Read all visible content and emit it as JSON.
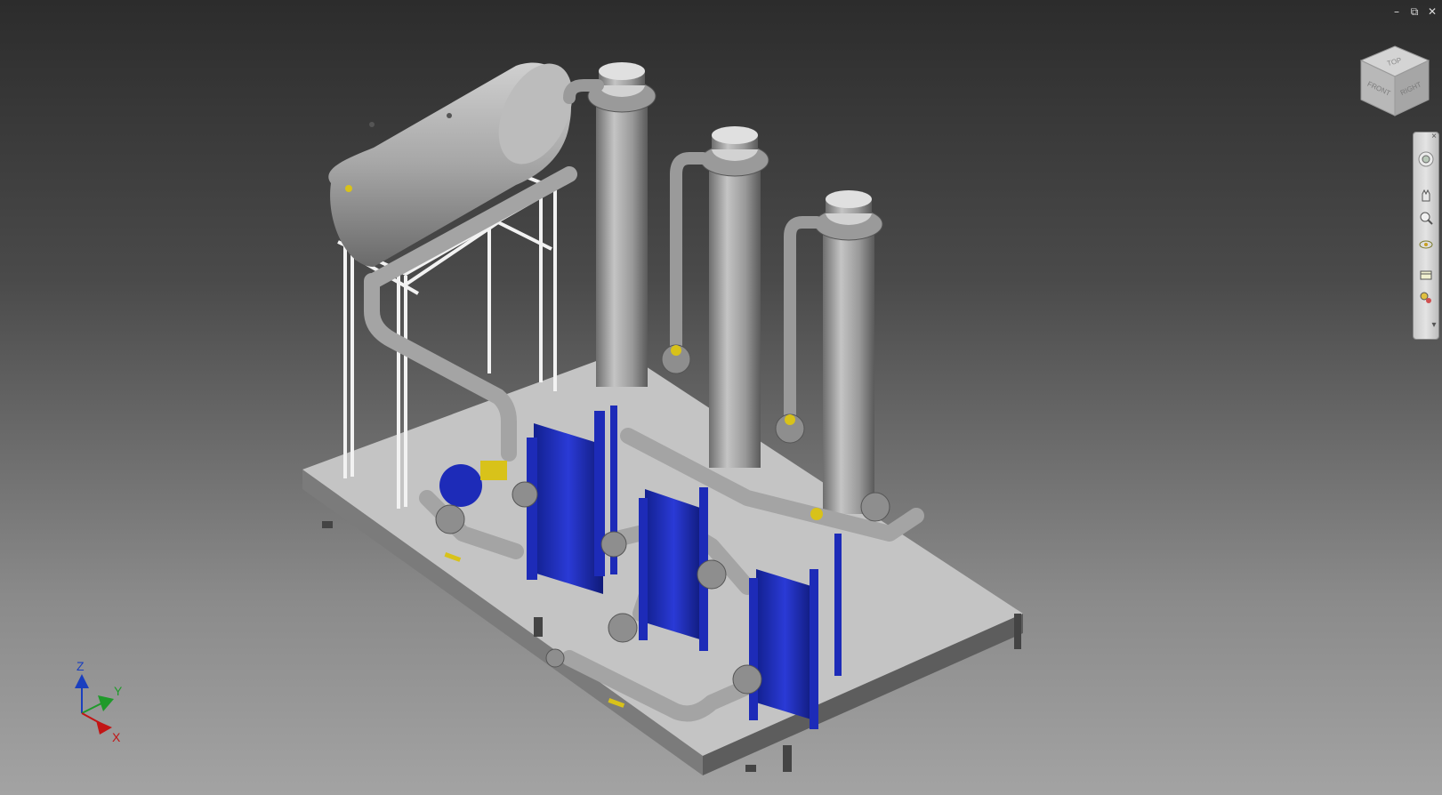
{
  "window": {
    "minimize_icon": "minimize-icon",
    "restore_icon": "restore-icon",
    "close_icon": "close-icon",
    "minimize_glyph": "–",
    "restore_glyph": "⧉",
    "close_glyph": "✕"
  },
  "viewcube": {
    "top_label": "TOP",
    "front_label": "FRONT",
    "right_label": "RIGHT"
  },
  "navigation_bar": {
    "tools": [
      "steering-wheel-icon",
      "pan-icon",
      "zoom-icon",
      "orbit-icon",
      "look-at-icon",
      "walk-icon"
    ],
    "close_glyph": "×",
    "menu_glyph": "▾"
  },
  "triad": {
    "z_label": "Z",
    "y_label": "Y",
    "x_label": "X"
  },
  "colors": {
    "steel": "#a8a8a8",
    "base": "#c4c4c4",
    "exchanger_blue": "#1d2bb8",
    "frame_white": "#f2f2f2",
    "valve_yellow": "#d8c21a",
    "axis_z": "#1a3fbf",
    "axis_y": "#1f9a2a",
    "axis_x": "#c21515"
  }
}
